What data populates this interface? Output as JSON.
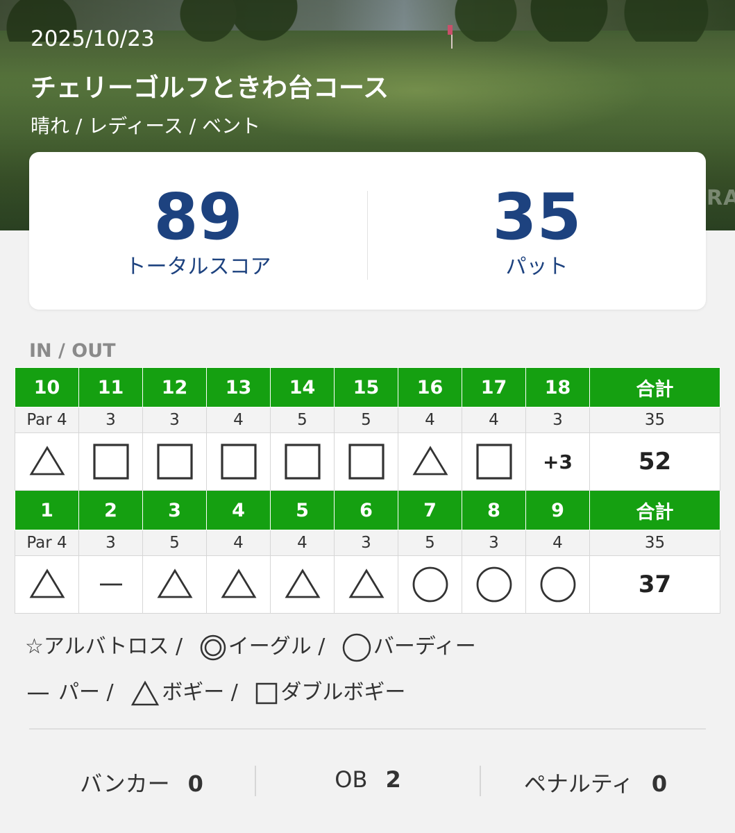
{
  "header": {
    "date": "2025/10/23",
    "course_name": "チェリーゴルフときわ台コース",
    "conditions": "晴れ / レディース  / ベント",
    "watermark": "RA"
  },
  "summary": {
    "total_score": "89",
    "total_score_label": "トータルスコア",
    "putts": "35",
    "putts_label": "パット"
  },
  "section_label": "IN / OUT",
  "scorecard": [
    {
      "holes": [
        "10",
        "11",
        "12",
        "13",
        "14",
        "15",
        "16",
        "17",
        "18"
      ],
      "total_label": "合計",
      "par": [
        "Par 4",
        "3",
        "3",
        "4",
        "5",
        "5",
        "4",
        "4",
        "3"
      ],
      "par_total": "35",
      "results": [
        "bogey",
        "double-bogey",
        "double-bogey",
        "double-bogey",
        "double-bogey",
        "double-bogey",
        "bogey",
        "double-bogey",
        "+3"
      ],
      "score_total": "52"
    },
    {
      "holes": [
        "1",
        "2",
        "3",
        "4",
        "5",
        "6",
        "7",
        "8",
        "9"
      ],
      "total_label": "合計",
      "par": [
        "Par 4",
        "3",
        "5",
        "4",
        "4",
        "3",
        "5",
        "3",
        "4"
      ],
      "par_total": "35",
      "results": [
        "bogey",
        "par",
        "bogey",
        "bogey",
        "bogey",
        "bogey",
        "birdie",
        "birdie",
        "birdie"
      ],
      "score_total": "37"
    }
  ],
  "legend": {
    "albatross": "アルバトロス /",
    "eagle": "イーグル /",
    "birdie": "バーディー",
    "par": "パー /",
    "bogey": "ボギー /",
    "double_bogey": "ダブルボギー"
  },
  "stats": {
    "bunker_label": "バンカー",
    "bunker_value": "0",
    "ob_label": "OB",
    "ob_value": "2",
    "penalty_label": "ペナルティ",
    "penalty_value": "0"
  },
  "colors": {
    "header_green": "#15a011",
    "score_blue": "#1d427f"
  }
}
